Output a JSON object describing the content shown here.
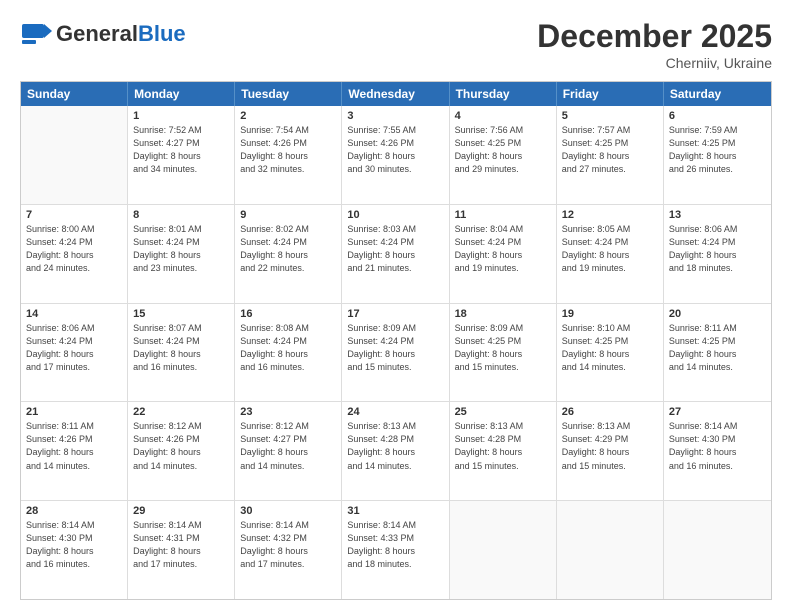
{
  "header": {
    "logo_general": "General",
    "logo_blue": "Blue",
    "month_title": "December 2025",
    "location": "Cherniiv, Ukraine"
  },
  "days_of_week": [
    "Sunday",
    "Monday",
    "Tuesday",
    "Wednesday",
    "Thursday",
    "Friday",
    "Saturday"
  ],
  "weeks": [
    [
      {
        "day": "",
        "info": "",
        "empty": true
      },
      {
        "day": "1",
        "info": "Sunrise: 7:52 AM\nSunset: 4:27 PM\nDaylight: 8 hours\nand 34 minutes."
      },
      {
        "day": "2",
        "info": "Sunrise: 7:54 AM\nSunset: 4:26 PM\nDaylight: 8 hours\nand 32 minutes."
      },
      {
        "day": "3",
        "info": "Sunrise: 7:55 AM\nSunset: 4:26 PM\nDaylight: 8 hours\nand 30 minutes."
      },
      {
        "day": "4",
        "info": "Sunrise: 7:56 AM\nSunset: 4:25 PM\nDaylight: 8 hours\nand 29 minutes."
      },
      {
        "day": "5",
        "info": "Sunrise: 7:57 AM\nSunset: 4:25 PM\nDaylight: 8 hours\nand 27 minutes."
      },
      {
        "day": "6",
        "info": "Sunrise: 7:59 AM\nSunset: 4:25 PM\nDaylight: 8 hours\nand 26 minutes."
      }
    ],
    [
      {
        "day": "7",
        "info": ""
      },
      {
        "day": "8",
        "info": "Sunrise: 8:01 AM\nSunset: 4:24 PM\nDaylight: 8 hours\nand 23 minutes."
      },
      {
        "day": "9",
        "info": "Sunrise: 8:02 AM\nSunset: 4:24 PM\nDaylight: 8 hours\nand 22 minutes."
      },
      {
        "day": "10",
        "info": "Sunrise: 8:03 AM\nSunset: 4:24 PM\nDaylight: 8 hours\nand 21 minutes."
      },
      {
        "day": "11",
        "info": "Sunrise: 8:04 AM\nSunset: 4:24 PM\nDaylight: 8 hours\nand 19 minutes."
      },
      {
        "day": "12",
        "info": "Sunrise: 8:05 AM\nSunset: 4:24 PM\nDaylight: 8 hours\nand 19 minutes."
      },
      {
        "day": "13",
        "info": "Sunrise: 8:06 AM\nSunset: 4:24 PM\nDaylight: 8 hours\nand 18 minutes."
      }
    ],
    [
      {
        "day": "14",
        "info": "Sunrise: 8:06 AM\nSunset: 4:24 PM\nDaylight: 8 hours\nand 17 minutes."
      },
      {
        "day": "15",
        "info": "Sunrise: 8:07 AM\nSunset: 4:24 PM\nDaylight: 8 hours\nand 16 minutes."
      },
      {
        "day": "16",
        "info": "Sunrise: 8:08 AM\nSunset: 4:24 PM\nDaylight: 8 hours\nand 16 minutes."
      },
      {
        "day": "17",
        "info": "Sunrise: 8:09 AM\nSunset: 4:24 PM\nDaylight: 8 hours\nand 15 minutes."
      },
      {
        "day": "18",
        "info": "Sunrise: 8:09 AM\nSunset: 4:25 PM\nDaylight: 8 hours\nand 15 minutes."
      },
      {
        "day": "19",
        "info": "Sunrise: 8:10 AM\nSunset: 4:25 PM\nDaylight: 8 hours\nand 14 minutes."
      },
      {
        "day": "20",
        "info": "Sunrise: 8:11 AM\nSunset: 4:25 PM\nDaylight: 8 hours\nand 14 minutes."
      }
    ],
    [
      {
        "day": "21",
        "info": "Sunrise: 8:11 AM\nSunset: 4:26 PM\nDaylight: 8 hours\nand 14 minutes."
      },
      {
        "day": "22",
        "info": "Sunrise: 8:12 AM\nSunset: 4:26 PM\nDaylight: 8 hours\nand 14 minutes."
      },
      {
        "day": "23",
        "info": "Sunrise: 8:12 AM\nSunset: 4:27 PM\nDaylight: 8 hours\nand 14 minutes."
      },
      {
        "day": "24",
        "info": "Sunrise: 8:13 AM\nSunset: 4:28 PM\nDaylight: 8 hours\nand 14 minutes."
      },
      {
        "day": "25",
        "info": "Sunrise: 8:13 AM\nSunset: 4:28 PM\nDaylight: 8 hours\nand 15 minutes."
      },
      {
        "day": "26",
        "info": "Sunrise: 8:13 AM\nSunset: 4:29 PM\nDaylight: 8 hours\nand 15 minutes."
      },
      {
        "day": "27",
        "info": "Sunrise: 8:14 AM\nSunset: 4:30 PM\nDaylight: 8 hours\nand 16 minutes."
      }
    ],
    [
      {
        "day": "28",
        "info": "Sunrise: 8:14 AM\nSunset: 4:30 PM\nDaylight: 8 hours\nand 16 minutes."
      },
      {
        "day": "29",
        "info": "Sunrise: 8:14 AM\nSunset: 4:31 PM\nDaylight: 8 hours\nand 17 minutes."
      },
      {
        "day": "30",
        "info": "Sunrise: 8:14 AM\nSunset: 4:32 PM\nDaylight: 8 hours\nand 17 minutes."
      },
      {
        "day": "31",
        "info": "Sunrise: 8:14 AM\nSunset: 4:33 PM\nDaylight: 8 hours\nand 18 minutes."
      },
      {
        "day": "",
        "info": "",
        "empty": true
      },
      {
        "day": "",
        "info": "",
        "empty": true
      },
      {
        "day": "",
        "info": "",
        "empty": true
      }
    ]
  ]
}
